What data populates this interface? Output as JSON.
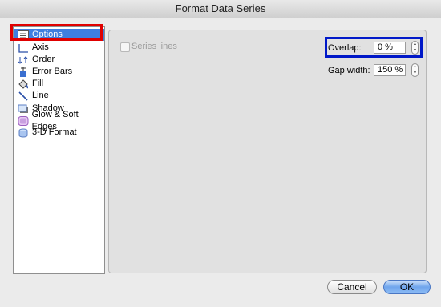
{
  "window": {
    "title": "Format Data Series"
  },
  "sidebar": {
    "items": [
      {
        "label": "Options",
        "icon": "options-icon",
        "selected": true
      },
      {
        "label": "Axis",
        "icon": "axis-icon",
        "selected": false
      },
      {
        "label": "Order",
        "icon": "order-icon",
        "selected": false
      },
      {
        "label": "Error Bars",
        "icon": "error-bars-icon",
        "selected": false
      },
      {
        "label": "Fill",
        "icon": "fill-bucket-icon",
        "selected": false
      },
      {
        "label": "Line",
        "icon": "line-icon",
        "selected": false
      },
      {
        "label": "Shadow",
        "icon": "shadow-icon",
        "selected": false
      },
      {
        "label": "Glow & Soft Edges",
        "icon": "glow-icon",
        "selected": false
      },
      {
        "label": "3-D Format",
        "icon": "3d-format-icon",
        "selected": false
      }
    ]
  },
  "options": {
    "series_lines_label": "Series lines",
    "series_lines_checked": false,
    "overlap_label": "Overlap:",
    "overlap_value": "0 %",
    "gap_width_label": "Gap width:",
    "gap_width_value": "150 %"
  },
  "buttons": {
    "cancel": "Cancel",
    "ok": "OK"
  },
  "colors": {
    "selection": "#3f7fe0",
    "red_highlight": "#e00000",
    "blue_highlight": "#0018c8"
  }
}
